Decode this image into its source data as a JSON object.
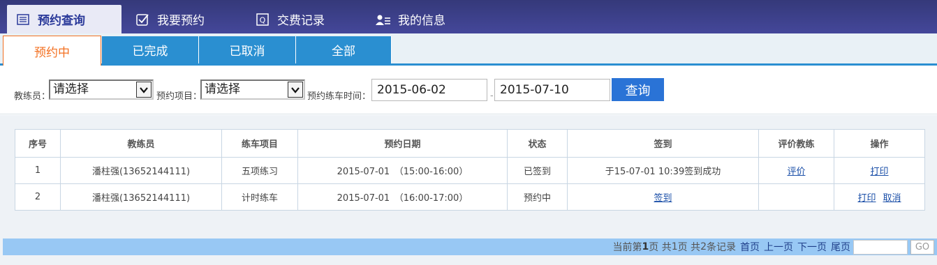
{
  "topnav": {
    "tabs": [
      {
        "label": "预约查询",
        "icon": "list-icon"
      },
      {
        "label": "我要预约",
        "icon": "checkbox-icon"
      },
      {
        "label": "交费记录",
        "icon": "receipt-icon"
      },
      {
        "label": "我的信息",
        "icon": "user-icon"
      }
    ]
  },
  "subtabs": [
    "预约中",
    "已完成",
    "已取消",
    "全部"
  ],
  "filter": {
    "coach_label": "教练员：",
    "coach_value": "请选择",
    "project_label": "预约项目：",
    "project_value": "请选择",
    "time_label": "预约练车时间：",
    "date_from": "2015-06-02",
    "date_to": "2015-07-10",
    "separator": "-",
    "query_label": "查询"
  },
  "table": {
    "headers": [
      "序号",
      "教练员",
      "练车项目",
      "预约日期",
      "状态",
      "签到",
      "评价教练",
      "操作"
    ],
    "rows": [
      {
        "no": "1",
        "coach": "潘柱强(13652144111)",
        "project": "五项练习",
        "date": "2015-07-01　（15:00-16:00）",
        "status": "已签到",
        "checkin": "于15-07-01 10:39签到成功",
        "evaluate": "评价",
        "op1": "打印",
        "op2": ""
      },
      {
        "no": "2",
        "coach": "潘柱强(13652144111)",
        "project": "计时练车",
        "date": "2015-07-01　（16:00-17:00）",
        "status": "预约中",
        "checkin": "签到",
        "evaluate": "",
        "op1": "打印",
        "op2": "取消"
      }
    ]
  },
  "pager": {
    "prefix": "当前第",
    "current": "1",
    "mid1": "页 共",
    "total_pages": "1",
    "mid2": "页 共",
    "total_records": "2",
    "suffix": "条记录",
    "first": "首页",
    "prev": "上一页",
    "next": "下一页",
    "last": "尾页",
    "go": "GO"
  },
  "colors": {
    "nav_bg": "#3d4190",
    "accent": "#2a8fd1",
    "active_orange": "#f37021",
    "pager_bg": "#98c8f4"
  }
}
